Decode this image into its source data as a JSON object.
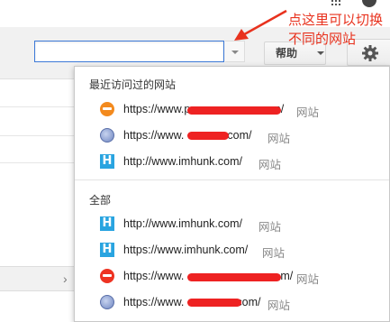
{
  "header": {
    "site_input_value": "",
    "help_label": "帮助"
  },
  "annotation": {
    "text": "点这里可以切换不同的网站",
    "color": "#e8321e"
  },
  "menu": {
    "recent_title": "最近访问过的网站",
    "all_title": "全部",
    "recent_items": [
      {
        "icon": "orange-site-icon",
        "url_start": "https://www.p",
        "url_end": "m/",
        "kind": "网站"
      },
      {
        "icon": "globe-icon",
        "url_start": "https://www.",
        "url_end": "com/",
        "kind": "网站"
      },
      {
        "icon": "imhunk-h-icon",
        "url": "http://www.imhunk.com/",
        "kind": "网站"
      }
    ],
    "all_items": [
      {
        "icon": "imhunk-h-icon",
        "url": "http://www.imhunk.com/",
        "kind": "网站"
      },
      {
        "icon": "imhunk-h-icon",
        "url": "https://www.imhunk.com/",
        "kind": "网站"
      },
      {
        "icon": "red-site-icon",
        "url_start": "https://www.",
        "url_end": "m/",
        "kind": "网站"
      },
      {
        "icon": "globe-icon",
        "url_start": "https://www.",
        "url_end": "com/",
        "kind": "网站"
      }
    ]
  },
  "colors": {
    "accent_blue": "#3d7ad8",
    "redaction": "#ee2222",
    "h_icon": "#29a4e0"
  }
}
